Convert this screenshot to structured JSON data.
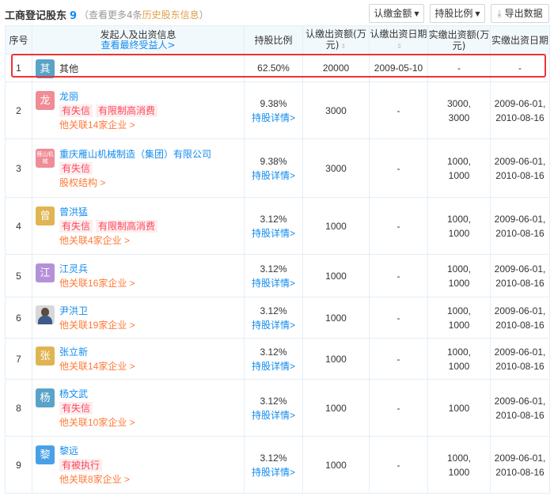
{
  "header": {
    "title": "工商登记股东",
    "count": "9",
    "more_text": "（查看更多4条",
    "history_link": "历史股东信息",
    "more_close": "）",
    "buttons": {
      "amount": "认缴金额",
      "ratio": "持股比例",
      "export": "导出数据"
    }
  },
  "table": {
    "columns": {
      "seq": "序号",
      "info": "发起人及出资信息",
      "info_sub": "查看最终受益人>",
      "ratio": "持股比例",
      "subscribed": "认缴出资额(万元)",
      "sub_date": "认缴出资日期",
      "paid": "实缴出资额(万元)",
      "paid_date": "实缴出资日期"
    },
    "rows": [
      {
        "seq": "1",
        "avatar": "其",
        "avatar_color": "#5aa3c8",
        "name": "其他",
        "tags": [],
        "rel": "",
        "ratio": "62.50%",
        "detail": "",
        "subscribed": "20000",
        "sub_date": "2009-05-10",
        "paid_1": "-",
        "paid_2": "",
        "paid_date_1": "-",
        "paid_date_2": ""
      },
      {
        "seq": "2",
        "avatar": "龙",
        "avatar_color": "#f08c96",
        "name": "龙丽",
        "tags": [
          "有失信",
          "有限制高消费"
        ],
        "rel": "他关联14家企业 >",
        "ratio": "9.38%",
        "detail": "持股详情>",
        "subscribed": "3000",
        "sub_date": "-",
        "paid_1": "3000,",
        "paid_2": "3000",
        "paid_date_1": "2009-06-01,",
        "paid_date_2": "2010-08-16"
      },
      {
        "seq": "3",
        "avatar": "雁山机械",
        "avatar_color": "#f08c96",
        "name": "重庆雁山机械制造（集团）有限公司",
        "tags": [
          "有失信"
        ],
        "rel": "股权结构 >",
        "ratio": "9.38%",
        "detail": "持股详情>",
        "subscribed": "3000",
        "sub_date": "-",
        "paid_1": "1000,",
        "paid_2": "1000",
        "paid_date_1": "2009-06-01,",
        "paid_date_2": "2010-08-16"
      },
      {
        "seq": "4",
        "avatar": "曾",
        "avatar_color": "#e0b452",
        "name": "曾洪猛",
        "tags": [
          "有失信",
          "有限制高消费"
        ],
        "rel": "他关联4家企业 >",
        "ratio": "3.12%",
        "detail": "持股详情>",
        "subscribed": "1000",
        "sub_date": "-",
        "paid_1": "1000,",
        "paid_2": "1000",
        "paid_date_1": "2009-06-01,",
        "paid_date_2": "2010-08-16"
      },
      {
        "seq": "5",
        "avatar": "江",
        "avatar_color": "#b592d8",
        "name": "江灵兵",
        "tags": [],
        "rel": "他关联16家企业 >",
        "ratio": "3.12%",
        "detail": "持股详情>",
        "subscribed": "1000",
        "sub_date": "-",
        "paid_1": "1000,",
        "paid_2": "1000",
        "paid_date_1": "2009-06-01,",
        "paid_date_2": "2010-08-16"
      },
      {
        "seq": "6",
        "avatar": "",
        "avatar_color": "#d8d8d8",
        "name": "尹洪卫",
        "tags": [],
        "rel": "他关联19家企业 >",
        "ratio": "3.12%",
        "detail": "持股详情>",
        "subscribed": "1000",
        "sub_date": "-",
        "paid_1": "1000,",
        "paid_2": "1000",
        "paid_date_1": "2009-06-01,",
        "paid_date_2": "2010-08-16"
      },
      {
        "seq": "7",
        "avatar": "张",
        "avatar_color": "#e0b452",
        "name": "张立新",
        "tags": [],
        "rel": "他关联14家企业 >",
        "ratio": "3.12%",
        "detail": "持股详情>",
        "subscribed": "1000",
        "sub_date": "-",
        "paid_1": "1000,",
        "paid_2": "1000",
        "paid_date_1": "2009-06-01,",
        "paid_date_2": "2010-08-16"
      },
      {
        "seq": "8",
        "avatar": "杨",
        "avatar_color": "#5aa3c8",
        "name": "杨文武",
        "tags": [
          "有失信"
        ],
        "rel": "他关联10家企业 >",
        "ratio": "3.12%",
        "detail": "持股详情>",
        "subscribed": "1000",
        "sub_date": "-",
        "paid_1": "1000",
        "paid_2": "",
        "paid_date_1": "2009-06-01,",
        "paid_date_2": "2010-08-16"
      },
      {
        "seq": "9",
        "avatar": "黎",
        "avatar_color": "#4aa0e6",
        "name": "黎远",
        "tags": [
          "有被执行"
        ],
        "rel": "他关联8家企业 >",
        "ratio": "3.12%",
        "detail": "持股详情>",
        "subscribed": "1000",
        "sub_date": "-",
        "paid_1": "1000,",
        "paid_2": "1000",
        "paid_date_1": "2009-06-01,",
        "paid_date_2": "2010-08-16"
      }
    ]
  }
}
